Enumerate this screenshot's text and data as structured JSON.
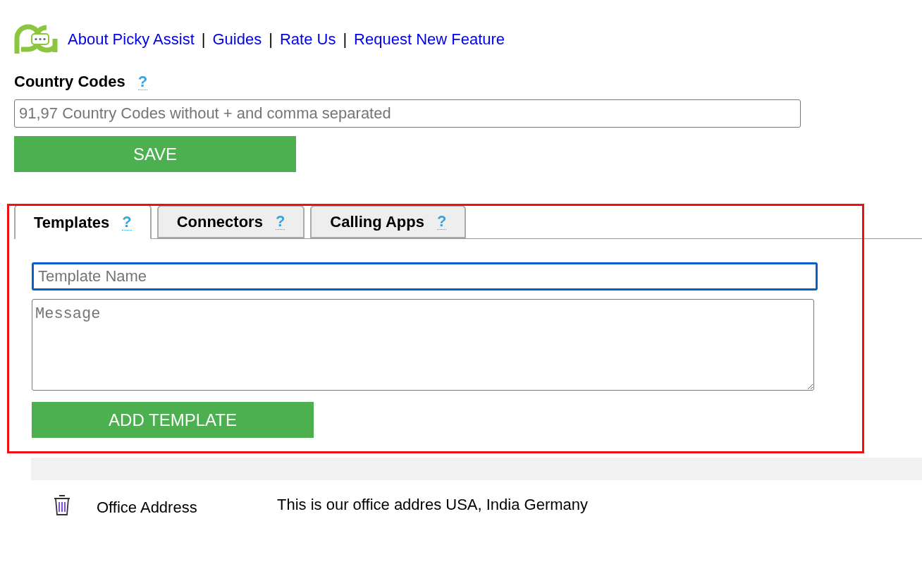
{
  "header": {
    "links": [
      {
        "label": "About Picky Assist"
      },
      {
        "label": "Guides"
      },
      {
        "label": "Rate Us"
      },
      {
        "label": "Request New Feature"
      }
    ],
    "separator": "|"
  },
  "country_codes": {
    "label": "Country Codes",
    "help": "?",
    "placeholder": "91,97 Country Codes without + and comma separated",
    "button": "SAVE"
  },
  "tabs": [
    {
      "label": "Templates",
      "help": "?",
      "selected": true
    },
    {
      "label": "Connectors",
      "help": "?",
      "selected": false
    },
    {
      "label": "Calling Apps",
      "help": "?",
      "selected": false
    }
  ],
  "template_form": {
    "name_placeholder": "Template Name",
    "message_placeholder": "Message",
    "button": "ADD TEMPLATE"
  },
  "templates": [
    {
      "name": "Office Address",
      "message": "This is our office addres USA, India Germany"
    }
  ]
}
